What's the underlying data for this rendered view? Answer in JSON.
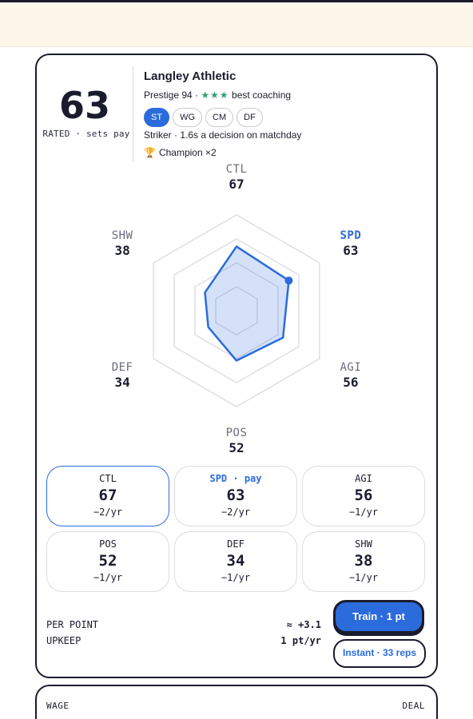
{
  "rating": {
    "value": "63",
    "label": "RATED · sets pay"
  },
  "club": {
    "name": "Langley Athletic",
    "prestige": "Prestige 94 ·",
    "stars": "★★★",
    "coaching": "best coaching"
  },
  "positions": [
    {
      "label": "ST",
      "active": true
    },
    {
      "label": "WG",
      "active": false
    },
    {
      "label": "CM",
      "active": false
    },
    {
      "label": "DF",
      "active": false
    }
  ],
  "role_text": "Striker · 1.6s a decision on matchday",
  "honour": {
    "icon": "trophy-icon",
    "text": "Champion ×2"
  },
  "radar": {
    "max": 100,
    "rings": [
      25,
      50,
      75
    ],
    "accent": "#2c6bdc",
    "highlight": "SPD",
    "axes": [
      {
        "key": "CTL",
        "value": 67,
        "display": "67"
      },
      {
        "key": "SPD",
        "value": 63,
        "display": "63"
      },
      {
        "key": "AGI",
        "value": 56,
        "display": "56"
      },
      {
        "key": "POS",
        "value": 52,
        "display": "52"
      },
      {
        "key": "DEF",
        "value": 34,
        "display": "34"
      },
      {
        "key": "SHW",
        "value": 38,
        "display": "38"
      }
    ]
  },
  "tiles": [
    {
      "label": "CTL",
      "value": "67",
      "delta": "−2/yr"
    },
    {
      "label": "SPD · pay",
      "value": "63",
      "delta": "−2/yr"
    },
    {
      "label": "AGI",
      "value": "56",
      "delta": "−1/yr"
    },
    {
      "label": "POS",
      "value": "52",
      "delta": "−1/yr"
    },
    {
      "label": "DEF",
      "value": "34",
      "delta": "−1/yr"
    },
    {
      "label": "SHW",
      "value": "38",
      "delta": "−1/yr"
    }
  ],
  "footer": {
    "per_point_label": "PER POINT",
    "per_point_value": "≈ +3.1",
    "upkeep_label": "UPKEEP",
    "upkeep_value": "1 pt/yr"
  },
  "buttons": {
    "train": "Train · 1 pt",
    "instant": "Instant · 33 reps"
  },
  "next_card": {
    "left": "WAGE",
    "right": "DEAL"
  },
  "colors": {
    "accent": "#2c6bdc",
    "ink": "#1a1c2e",
    "banner": "#fcf7ea",
    "stars": "#2fa36b"
  }
}
